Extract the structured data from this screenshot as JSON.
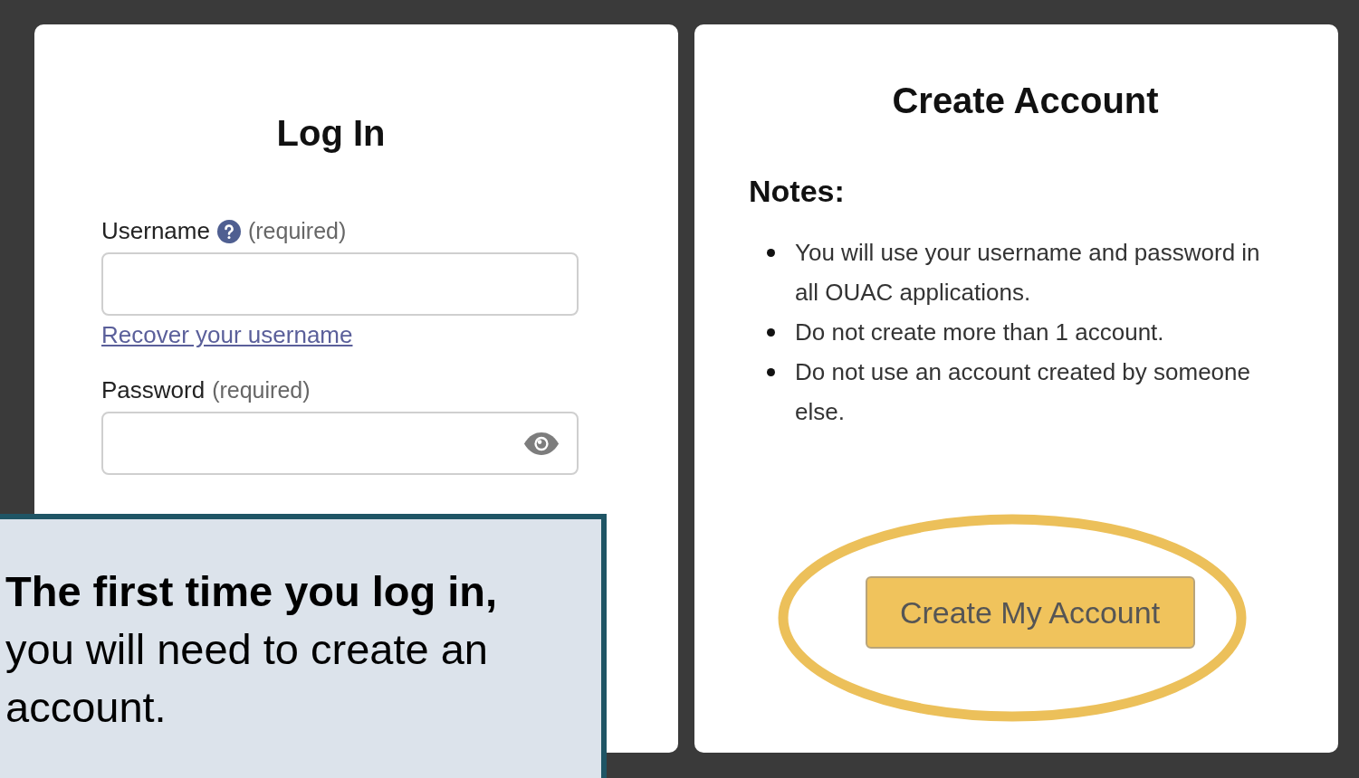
{
  "login": {
    "title": "Log In",
    "fields": [
      {
        "label": "Username",
        "hint": "(required)",
        "help": true,
        "link": "Recover your username",
        "kind": "text"
      },
      {
        "label": "Password",
        "hint": "(required)",
        "help": false,
        "kind": "password"
      }
    ]
  },
  "create_account": {
    "title": "Create Account",
    "notes_heading": "Notes:",
    "notes": [
      "You will use your username and password in all OUAC applications.",
      "Do not create more than 1 account.",
      "Do not use an account created by someone else."
    ],
    "button": "Create My Account"
  },
  "callout": {
    "text": "**The first time you log in,** you will need to create an account."
  }
}
